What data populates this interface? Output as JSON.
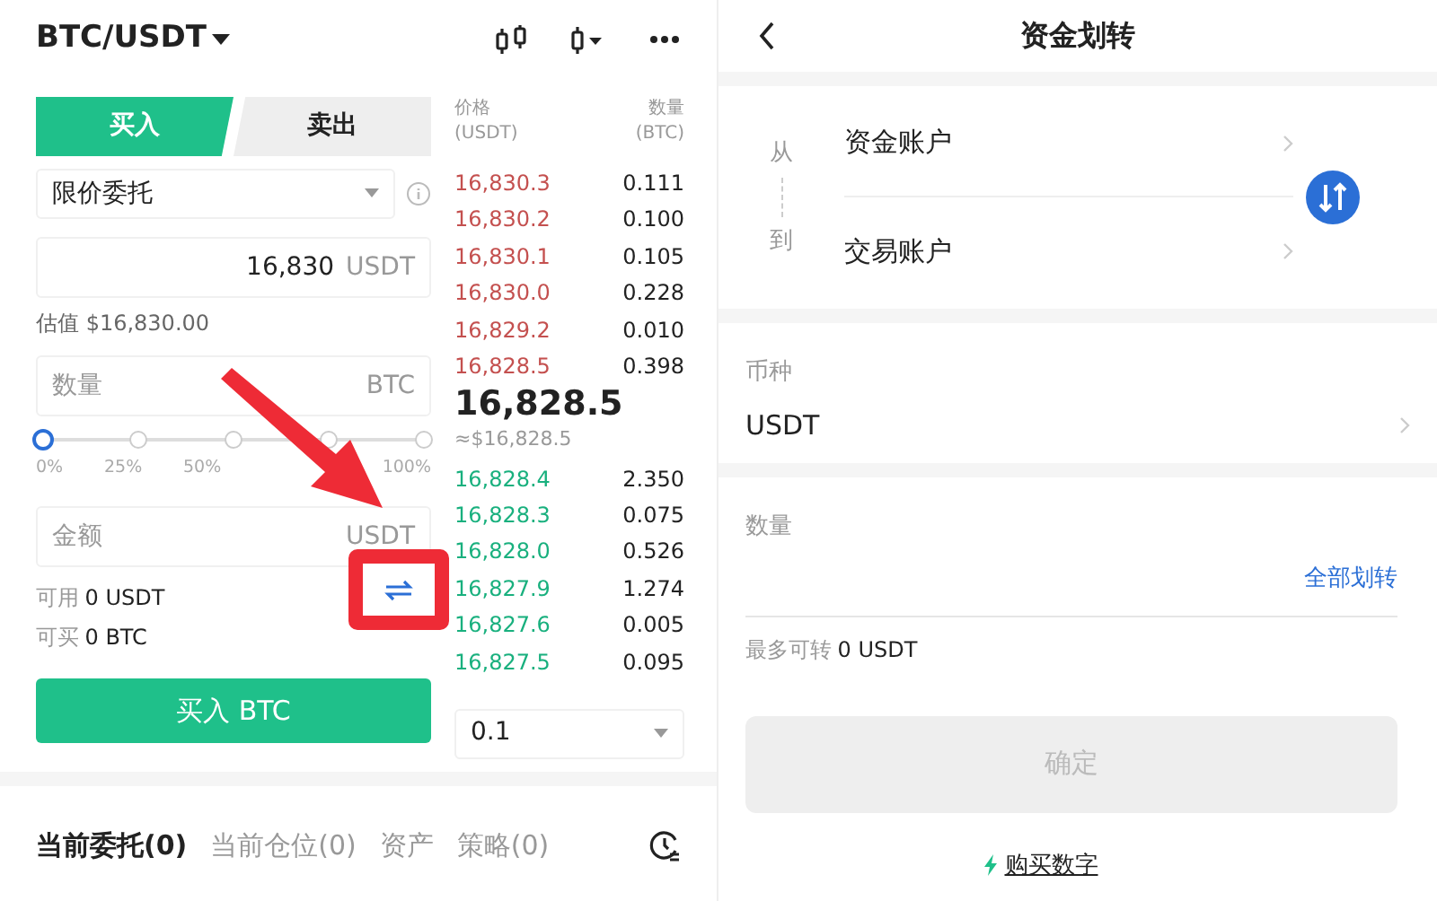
{
  "trade": {
    "pair": "BTC/USDT",
    "sides": [
      {
        "label": "买入",
        "selected": true
      },
      {
        "label": "卖出",
        "selected": false
      }
    ],
    "order_type": "限价委托",
    "price": {
      "value": "16,830",
      "unit": "USDT"
    },
    "estimate": "估值 $16,830.00",
    "quantity": {
      "placeholder": "数量",
      "unit": "BTC"
    },
    "slider": {
      "level": 0,
      "marks": [
        "0%",
        "25%",
        "50%",
        "100%"
      ]
    },
    "amount": {
      "placeholder": "金额",
      "unit": "USDT"
    },
    "available": [
      {
        "label": "可用",
        "value": "0 USDT"
      },
      {
        "label": "可买",
        "value": "0 BTC"
      }
    ],
    "submit": "买入 BTC",
    "orderbook": {
      "headers": [
        {
          "label": "价格",
          "sub": "(USDT)"
        },
        {
          "label": "数量",
          "sub": "(BTC)"
        }
      ],
      "asks": [
        {
          "price": "16,830.3",
          "qty": "0.111"
        },
        {
          "price": "16,830.2",
          "qty": "0.100"
        },
        {
          "price": "16,830.1",
          "qty": "0.105"
        },
        {
          "price": "16,830.0",
          "qty": "0.228"
        },
        {
          "price": "16,829.2",
          "qty": "0.010"
        },
        {
          "price": "16,828.5",
          "qty": "0.398"
        }
      ],
      "last": "16,828.5",
      "last_usd": "≈$16,828.5",
      "bids": [
        {
          "price": "16,828.4",
          "qty": "2.350"
        },
        {
          "price": "16,828.3",
          "qty": "0.075"
        },
        {
          "price": "16,828.0",
          "qty": "0.526"
        },
        {
          "price": "16,827.9",
          "qty": "1.274"
        },
        {
          "price": "16,827.6",
          "qty": "0.005"
        },
        {
          "price": "16,827.5",
          "qty": "0.095"
        }
      ],
      "depth": "0.1"
    },
    "bottom_tabs": [
      {
        "label": "当前委托(0)",
        "selected": true
      },
      {
        "label": "当前仓位(0)",
        "selected": false
      },
      {
        "label": "资产",
        "selected": false
      },
      {
        "label": "策略(0)",
        "selected": false
      }
    ]
  },
  "transfer": {
    "title": "资金划转",
    "from_label": "从",
    "to_label": "到",
    "from": "资金账户",
    "to": "交易账户",
    "currency_label": "币种",
    "currency": "USDT",
    "quantity_label": "数量",
    "all": "全部划转",
    "max_label": "最多可转",
    "max_value": "0 USDT",
    "confirm": {
      "label": "确定",
      "disabled": true
    },
    "buy_link": "购买数字"
  }
}
